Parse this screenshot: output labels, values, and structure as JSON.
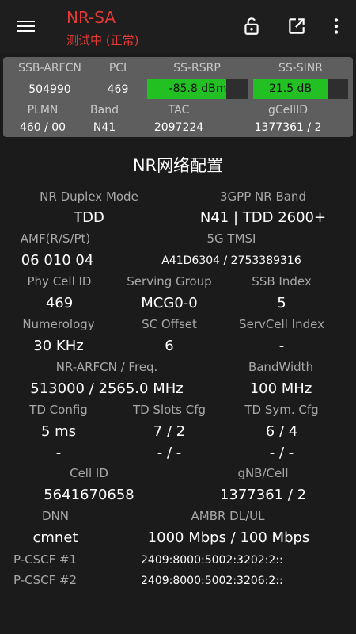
{
  "header": {
    "title": "NR-SA",
    "subtitle": "测试中 (正常)",
    "icons": [
      "menu-icon",
      "lock-open-icon",
      "open-in-new-icon",
      "more-vert-icon"
    ],
    "accent_color": "#e53935"
  },
  "summary": {
    "row1_labels": [
      "SSB-ARFCN",
      "PCI",
      "SS-RSRP",
      "SS-SINR"
    ],
    "ssb_arfcn": "504990",
    "pci": "469",
    "rsrp": {
      "text": "-85.8 dBm",
      "level": 0.78
    },
    "sinr": {
      "text": "21.5 dB",
      "level": 0.78
    },
    "bar_color": "#22c022",
    "row2_labels": [
      "PLMN",
      "Band",
      "TAC",
      "gCellID"
    ],
    "plmn": "460 / 00",
    "band": "N41",
    "tac": "2097224",
    "gcellid": "1377361 / 2"
  },
  "section": {
    "title": "NR网络配置",
    "duplex_label": "NR Duplex Mode",
    "duplex_value": "TDD",
    "band_label": "3GPP NR Band",
    "band_value": "N41 | TDD 2600+",
    "amf_label": "AMF(R/S/Pt)",
    "amf_value": "06 010 04",
    "tmsi_label": "5G TMSI",
    "tmsi_value": "A41D6304 / 2753389316",
    "phycell_label": "Phy Cell ID",
    "phycell_value": "469",
    "serving_label": "Serving Group",
    "serving_value": "MCG0-0",
    "ssb_label": "SSB Index",
    "ssb_value": "5",
    "numerology_label": "Numerology",
    "numerology_value": "30 KHz",
    "scoffset_label": "SC Offset",
    "scoffset_value": "6",
    "servcell_label": "ServCell Index",
    "servcell_value": "-",
    "arfcn_label": "NR-ARFCN / Freq.",
    "arfcn_value": "513000 / 2565.0 MHz",
    "bw_label": "BandWidth",
    "bw_value": "100 MHz",
    "tdcfg_label": "TD Config",
    "tdcfg_value1": "5 ms",
    "tdcfg_value2": "-",
    "tdslots_label": "TD Slots Cfg",
    "tdslots_value1": "7 / 2",
    "tdslots_value2": "- / -",
    "tdsym_label": "TD Sym. Cfg",
    "tdsym_value1": "6 / 4",
    "tdsym_value2": "- / -",
    "cellid_label": "Cell ID",
    "cellid_value": "5641670658",
    "gnb_label": "gNB/Cell",
    "gnb_value": "1377361 / 2",
    "dnn_label": "DNN",
    "dnn_value": "cmnet",
    "ambr_label": "AMBR DL/UL",
    "ambr_value": "1000 Mbps / 100 Mbps",
    "pcscf1_label": "P-CSCF #1",
    "pcscf1_value": "2409:8000:5002:3202:2::",
    "pcscf2_label": "P-CSCF #2",
    "pcscf2_value": "2409:8000:5002:3206:2::"
  }
}
